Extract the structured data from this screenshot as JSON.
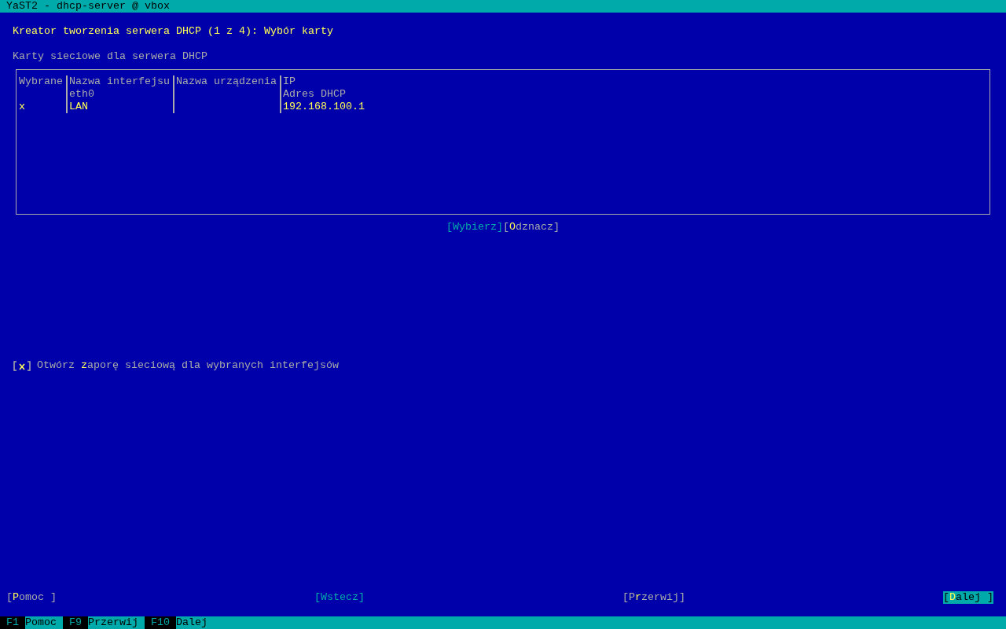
{
  "window": {
    "title": "YaST2 - dhcp-server @ vbox"
  },
  "heading": "Kreator tworzenia serwera DHCP (1 z 4): Wybór karty",
  "table": {
    "label": "Karty sieciowe dla serwera DHCP",
    "columns": [
      "Wybrane",
      "Nazwa interfejsu",
      "Nazwa urządzenia",
      "IP"
    ],
    "rows": [
      {
        "selected": false,
        "cells": [
          "",
          "eth0",
          "",
          "Adres DHCP"
        ]
      },
      {
        "selected": true,
        "cells": [
          "x",
          "LAN",
          "",
          "192.168.100.1"
        ]
      }
    ]
  },
  "table_buttons": [
    {
      "label": "[Wybierz]",
      "disabled": true,
      "default": false
    },
    {
      "label": "[**O**dznacz]",
      "disabled": false,
      "default": false
    }
  ],
  "firewall_checkbox": {
    "checked": true,
    "label": "Otwórz **z**aporę sieciową dla wybranych interfejsów"
  },
  "wizard_buttons": [
    {
      "label": "[**P**omoc ]",
      "disabled": false,
      "default": false
    },
    {
      "label": "[Wstecz]",
      "disabled": true,
      "default": false
    },
    {
      "label": "[P**r**zerwij]",
      "disabled": false,
      "default": false
    },
    {
      "label": "[**D**alej ]",
      "disabled": false,
      "default": true
    }
  ],
  "function_keys": [
    {
      "key": "F1",
      "label": "Pomoc"
    },
    {
      "key": "F9",
      "label": "Przerwij"
    },
    {
      "key": "F10",
      "label": "Dalej"
    }
  ]
}
